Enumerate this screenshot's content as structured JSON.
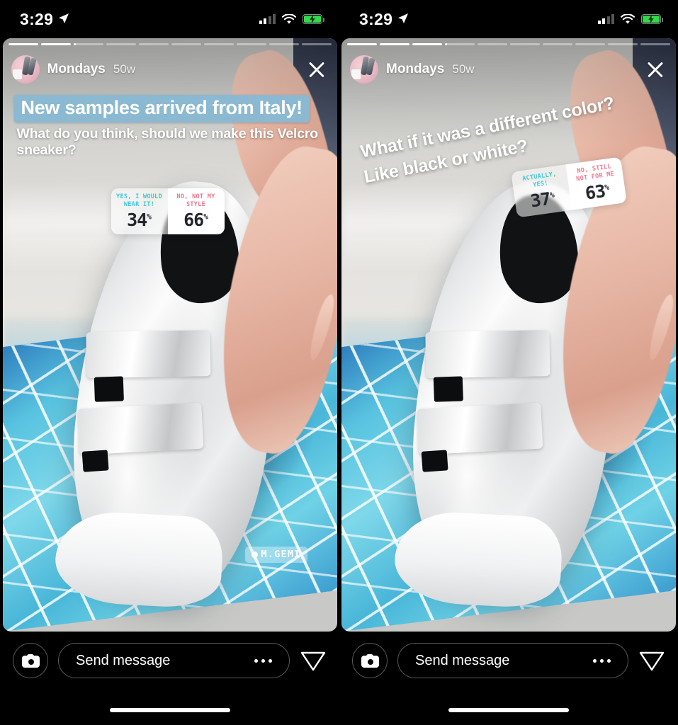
{
  "app": "Instagram Stories",
  "status_bar": {
    "time": "3:29",
    "location_icon": "location-arrow-icon",
    "cellular_icon": "signal-bars-icon",
    "wifi_icon": "wifi-icon",
    "battery_icon": "battery-charging-icon",
    "battery_charging": true,
    "battery_color": "#33d94a"
  },
  "stories": [
    {
      "id": "story-1",
      "progress": {
        "total_segments": 10,
        "current_index": 2,
        "current_fill_pct": 8
      },
      "header": {
        "username": "Mondays",
        "timestamp": "50w",
        "avatar_name": "profile-avatar",
        "close_label": "close-icon"
      },
      "headline": "New samples arrived from Italy!",
      "headline_bg": "#8bb9d2",
      "subline": "What do you think, should we make this Velcro sneaker?",
      "poll": {
        "options": [
          {
            "label": "YES, I WOULD WEAR IT!",
            "percent": "34",
            "percent_symbol": "%",
            "color": "#3ec6e0",
            "winner": false
          },
          {
            "label": "NO, NOT MY STYLE",
            "percent": "66",
            "percent_symbol": "%",
            "color": "#f0768c",
            "winner": true
          }
        ]
      },
      "location_sticker": {
        "text": "M.GEMI",
        "icon": "location-pin-icon"
      }
    },
    {
      "id": "story-2",
      "progress": {
        "total_segments": 10,
        "current_index": 3,
        "current_fill_pct": 6
      },
      "header": {
        "username": "Mondays",
        "timestamp": "50w",
        "avatar_name": "profile-avatar",
        "close_label": "close-icon"
      },
      "headline_line1": "What if it was a different color?",
      "headline_line2": "Like black or white?",
      "poll": {
        "options": [
          {
            "label": "ACTUALLY, YES!",
            "percent": "37",
            "percent_symbol": "%",
            "color": "#3ec6e0",
            "winner": false
          },
          {
            "label": "NO, STILL NOT FOR ME",
            "percent": "63",
            "percent_symbol": "%",
            "color": "#f0768c",
            "winner": true
          }
        ]
      }
    }
  ],
  "bottom_bar": {
    "camera_icon": "camera-icon",
    "message_placeholder": "Send message",
    "more_icon": "more-options-icon",
    "send_icon": "send-direct-icon"
  }
}
